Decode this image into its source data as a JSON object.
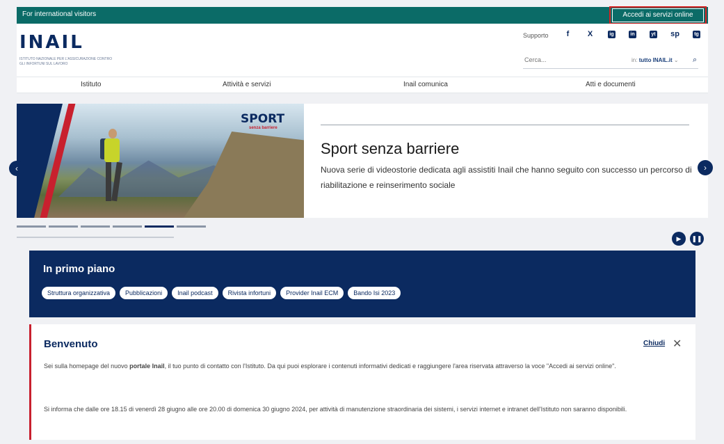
{
  "topbar": {
    "international": "For international visitors",
    "access_button": "Accedi ai servizi online"
  },
  "header": {
    "logo": "INAIL",
    "logo_sub": "ISTITUTO NAZIONALE PER L'ASSICURAZIONE CONTRO GLI INFORTUNI SUL LAVORO",
    "supporto": "Supporto",
    "social": [
      "f",
      "X",
      "ig",
      "in",
      "yt",
      "sp",
      "tg"
    ],
    "search_placeholder": "Cerca...",
    "search_scope_prefix": "in:",
    "search_scope": "tutto INAIL.it"
  },
  "nav": {
    "items": [
      "Istituto",
      "Attività e servizi",
      "Inail comunica",
      "Atti e documenti"
    ]
  },
  "hero": {
    "badge": "SPORT",
    "badge_sub": "senza barriere",
    "title": "Sport senza barriere",
    "description": "Nuova serie di videostorie dedicata agli assistiti Inail che hanno seguito con successo un percorso di riabilitazione e reinserimento sociale",
    "slide_count": 6,
    "active_slide": 5
  },
  "primo_piano": {
    "title": "In primo piano",
    "pills": [
      "Struttura organizzativa",
      "Pubblicazioni",
      "Inail podcast",
      "Rivista infortuni",
      "Provider Inail ECM",
      "Bando Isi 2023"
    ]
  },
  "welcome": {
    "title": "Benvenuto",
    "close_label": "Chiudi",
    "p1_pre": "Sei sulla homepage del nuovo ",
    "p1_bold": "portale Inail",
    "p1_post": ", il tuo punto di contatto con l'Istituto. Da qui puoi esplorare i contenuti informativi dedicati e raggiungere l'area riservata attraverso la voce \"Accedi ai servizi online\".",
    "p2": "Si informa che dalle ore 18.15 di venerdì 28 giugno alle ore 20.00 di domenica 30 giugno 2024, per attività di manutenzione straordinaria dei sistemi, i servizi internet e intranet dell'Istituto non saranno disponibili."
  },
  "colors": {
    "brand_navy": "#0b2a60",
    "brand_teal": "#0b6b67",
    "accent_red": "#c8202e"
  }
}
